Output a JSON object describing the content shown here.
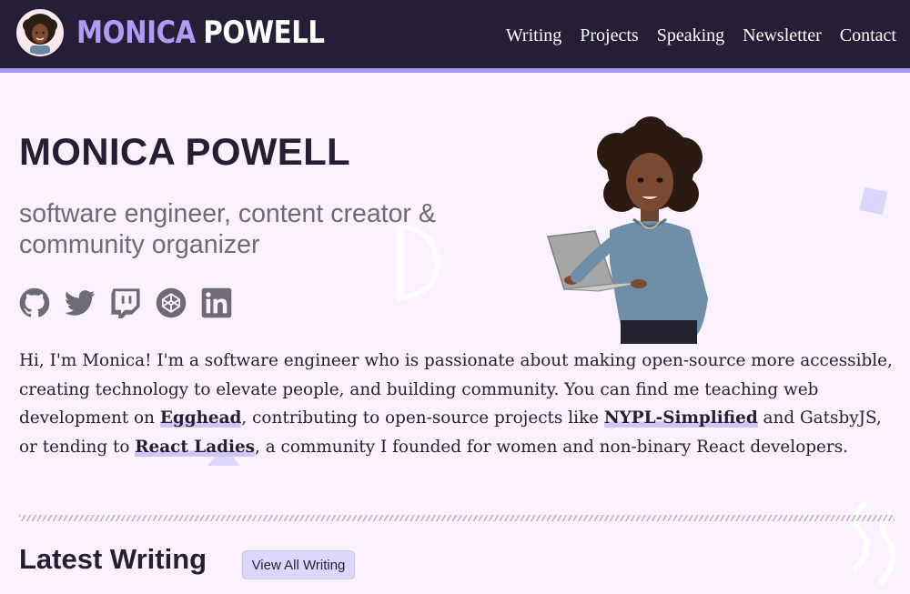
{
  "header": {
    "brand_first": "MONICA",
    "brand_last": "POWELL",
    "nav": [
      "Writing",
      "Projects",
      "Speaking",
      "Newsletter",
      "Contact"
    ]
  },
  "hero": {
    "title": "MONICA POWELL",
    "subtitle": "software engineer, content creator & community organizer",
    "socials": [
      "github-icon",
      "twitter-icon",
      "twitch-icon",
      "codepen-icon",
      "linkedin-icon"
    ]
  },
  "bio": {
    "text_1": "Hi, I'm Monica! I'm a software engineer who is passionate about making open-source more accessible, creating technology to elevate people, and building community. You can find me teaching web development on ",
    "link_egghead": "Egghead",
    "text_2": ", contributing to open-source projects like ",
    "link_nypl": "NYPL-Simplified",
    "text_3": " and GatsbyJS, or tending to ",
    "link_react_ladies": "React Ladies",
    "text_4": ", a community I founded for women and non-binary React developers."
  },
  "latest": {
    "title": "Latest Writing",
    "view_all_label": "View All Writing"
  },
  "colors": {
    "header_bg": "#251e34",
    "accent": "#a79af5",
    "page_bg": "#fbf1ff",
    "icon_gray": "#6e6a76"
  }
}
